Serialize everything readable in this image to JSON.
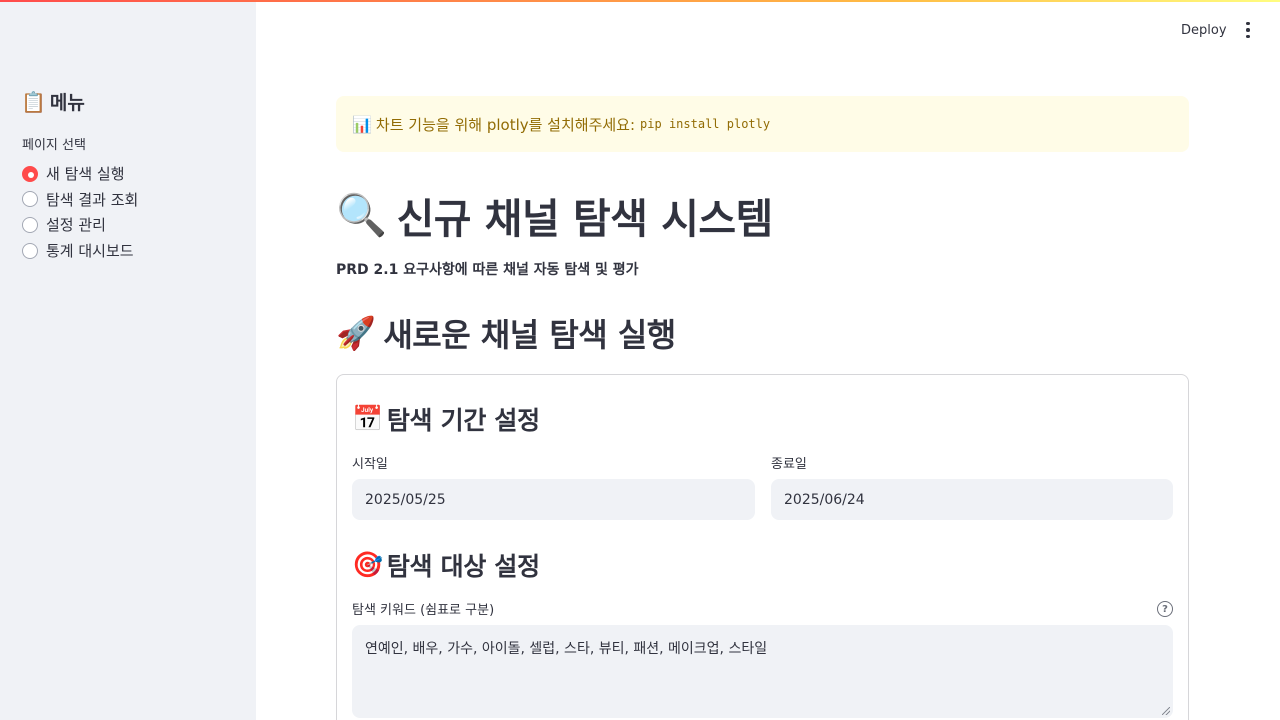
{
  "sidebar": {
    "title_icon": "clipboard-icon",
    "title_emoji": "📋",
    "title": "메뉴",
    "radio_label": "페이지 선택",
    "items": [
      {
        "label": "새 탐색 실행",
        "checked": true
      },
      {
        "label": "탐색 결과 조회",
        "checked": false
      },
      {
        "label": "설정 관리",
        "checked": false
      },
      {
        "label": "통계 대시보드",
        "checked": false
      }
    ]
  },
  "header": {
    "deploy_label": "Deploy",
    "menu_icon": "more-vertical-icon"
  },
  "warning": {
    "icon": "bar-chart-icon",
    "emoji": "📊",
    "text": "차트 기능을 위해 plotly를 설치해주세요:",
    "code": "pip install plotly"
  },
  "main": {
    "title_icon": "magnifier-icon",
    "title_emoji": "🔍",
    "title": "신규 채널 탐색 시스템",
    "subtitle": "PRD 2.1 요구사항에 따른 채널 자동 탐색 및 평가",
    "section_icon": "rocket-icon",
    "section_emoji": "🚀",
    "section_title": "새로운 채널 탐색 실행"
  },
  "form": {
    "period_icon": "calendar-icon",
    "period_emoji": "📅",
    "period_title": "탐색 기간 설정",
    "start_label": "시작일",
    "start_value": "2025/05/25",
    "end_label": "종료일",
    "end_value": "2025/06/24",
    "target_icon": "target-icon",
    "target_emoji": "🎯",
    "target_title": "탐색 대상 설정",
    "keywords_label": "탐색 키워드 (쉼표로 구분)",
    "keywords_value": "연예인, 배우, 가수, 아이돌, 셀럽, 스타, 뷰티, 패션, 메이크업, 스타일",
    "help_icon": "help-circle-icon"
  },
  "colors": {
    "accent": "#ff4b4b",
    "sidebar_bg": "#f0f2f6",
    "warning_bg": "#fffce7",
    "warning_text": "#926c05"
  }
}
